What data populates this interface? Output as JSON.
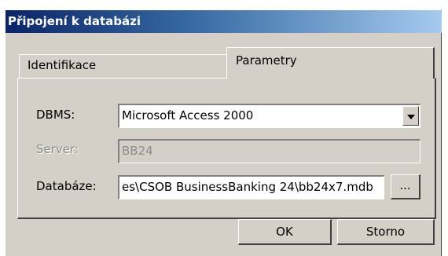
{
  "window": {
    "title": "Připojení k databázi"
  },
  "tabs": [
    {
      "label": "Identifikace",
      "active": false
    },
    {
      "label": "Parametry",
      "active": true
    }
  ],
  "form": {
    "dbms_label": "DBMS:",
    "dbms_value": "Microsoft Access 2000",
    "server_label": "Server:",
    "server_value": "BB24",
    "database_label": "Databáze:",
    "database_value": "es\\CSOB BusinessBanking 24\\bb24x7.mdb",
    "browse_label": "..."
  },
  "buttons": {
    "ok": "OK",
    "cancel": "Storno"
  }
}
